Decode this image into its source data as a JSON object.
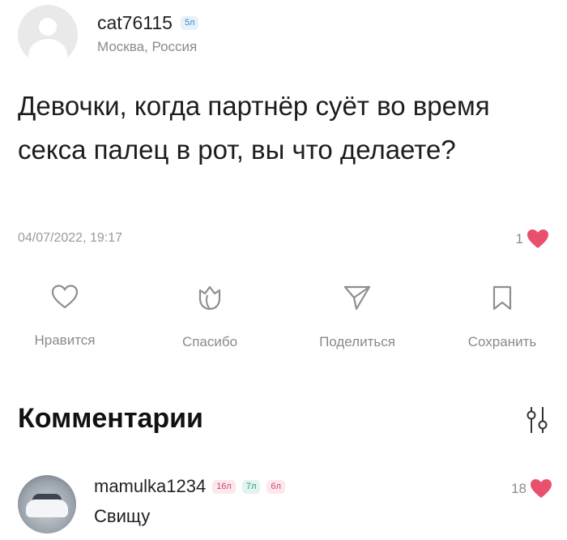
{
  "post": {
    "username": "cat76115",
    "user_badge": "5л",
    "location": "Москва, Россия",
    "text": "Девочки, когда партнёр суёт во время секса палец в рот, вы что делаете?",
    "timestamp": "04/07/2022, 19:17",
    "like_count": "1",
    "avatar_icon": "user-placeholder-icon",
    "like_color": "#e8506e"
  },
  "actions": [
    {
      "label": "Нравится",
      "icon": "heart-outline-icon"
    },
    {
      "label": "Спасибо",
      "icon": "flower-icon"
    },
    {
      "label": "Поделиться",
      "icon": "send-icon"
    },
    {
      "label": "Сохранить",
      "icon": "bookmark-icon"
    }
  ],
  "comments_section": {
    "title": "Комментарии",
    "filter_icon": "filter-sliders-icon",
    "comments": [
      {
        "username": "mamulka1234",
        "badges": [
          "16л",
          "7л",
          "6л"
        ],
        "text": "Свищу",
        "like_count": "18",
        "avatar_icon": "car-avatar"
      }
    ]
  }
}
